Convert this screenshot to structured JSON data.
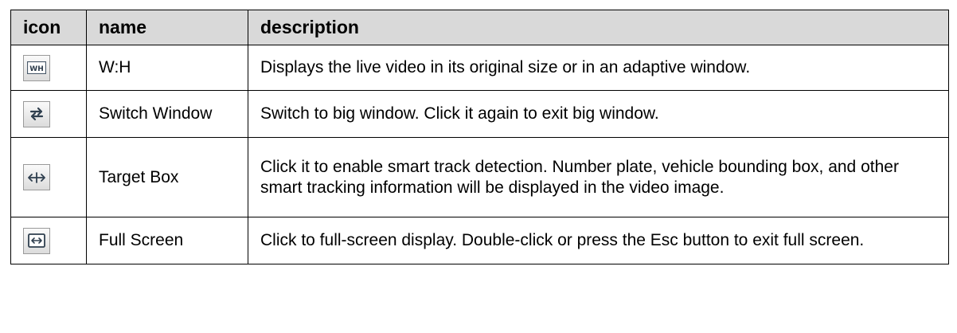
{
  "table": {
    "headers": {
      "icon": "icon",
      "name": "name",
      "description": "description"
    },
    "rows": [
      {
        "icon": "aspect-ratio-wh-icon",
        "name": "W:H",
        "description": "Displays the live video in its original size or in an adaptive window."
      },
      {
        "icon": "switch-window-icon",
        "name": "Switch Window",
        "description": "Switch to big window. Click it again to exit big window."
      },
      {
        "icon": "target-box-icon",
        "name": "Target Box",
        "description": "Click it to enable smart track detection. Number plate, vehicle bounding box, and other smart tracking information will be displayed in the video image."
      },
      {
        "icon": "full-screen-icon",
        "name": "Full Screen",
        "description": "Click to full-screen display. Double-click or press the Esc button to exit full screen."
      }
    ]
  }
}
